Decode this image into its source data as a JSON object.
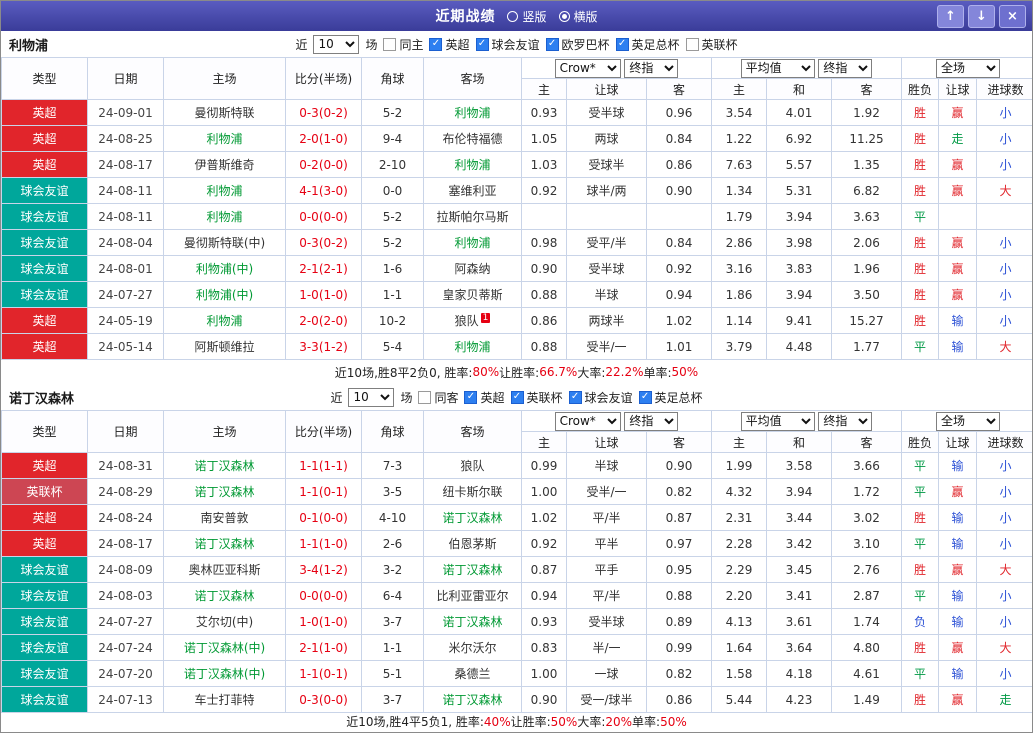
{
  "titlebar": {
    "title": "近期战绩",
    "radios": [
      {
        "label": "竖版",
        "selected": false
      },
      {
        "label": "横版",
        "selected": true
      }
    ],
    "icons": {
      "up": "↑",
      "down": "↓",
      "close": "×"
    }
  },
  "table": {
    "cols": [
      "类型",
      "日期",
      "主场",
      "比分(半场)",
      "角球",
      "客场"
    ],
    "groups": {
      "bookmaker": "Crow*",
      "final1": "终指",
      "average": "平均值",
      "final2": "终指",
      "full": "全场"
    },
    "asian_sub": [
      "主",
      "让球",
      "客"
    ],
    "euro_sub": [
      "主",
      "和",
      "客"
    ],
    "full_sub": [
      "胜负",
      "让球",
      "进球数"
    ]
  },
  "colors": {
    "type": {
      "英超": "#e1252b",
      "球会友谊": "#00a79b",
      "英联杯": "#cd4653"
    },
    "result": {
      "胜": "#e1252b",
      "平": "#009944",
      "负": "#2b50d5",
      "赢": "#e1252b",
      "走": "#009944",
      "输": "#2b50d5",
      "大": "#e1252b",
      "小": "#2b50d5"
    },
    "focus_team": "#009933",
    "score": "#e60012",
    "summary_label": "#222222",
    "summary_value": "#e60012"
  },
  "sections": [
    {
      "team": "利物浦",
      "filter": {
        "prefix": "近",
        "count": "10",
        "suffix": "场",
        "same": {
          "label": "同主",
          "checked": false
        },
        "leagues": [
          {
            "label": "英超",
            "checked": true
          },
          {
            "label": "球会友谊",
            "checked": true
          },
          {
            "label": "欧罗巴杯",
            "checked": true
          },
          {
            "label": "英足总杯",
            "checked": true
          },
          {
            "label": "英联杯",
            "checked": false
          }
        ]
      },
      "rows": [
        {
          "type": "英超",
          "date": "24-09-01",
          "home": "曼彻斯特联",
          "home_focus": false,
          "score": "0-3(0-2)",
          "corner": "5-2",
          "away": "利物浦",
          "away_focus": true,
          "asian": [
            "0.93",
            "受半球",
            "0.96"
          ],
          "euro": [
            "3.54",
            "4.01",
            "1.92"
          ],
          "full": [
            "胜",
            "赢",
            "小"
          ]
        },
        {
          "type": "英超",
          "date": "24-08-25",
          "home": "利物浦",
          "home_focus": true,
          "score": "2-0(1-0)",
          "corner": "9-4",
          "away": "布伦特福德",
          "away_focus": false,
          "asian": [
            "1.05",
            "两球",
            "0.84"
          ],
          "euro": [
            "1.22",
            "6.92",
            "11.25"
          ],
          "full": [
            "胜",
            "走",
            "小"
          ]
        },
        {
          "type": "英超",
          "date": "24-08-17",
          "home": "伊普斯维奇",
          "home_focus": false,
          "score": "0-2(0-0)",
          "corner": "2-10",
          "away": "利物浦",
          "away_focus": true,
          "asian": [
            "1.03",
            "受球半",
            "0.86"
          ],
          "euro": [
            "7.63",
            "5.57",
            "1.35"
          ],
          "full": [
            "胜",
            "赢",
            "小"
          ]
        },
        {
          "type": "球会友谊",
          "date": "24-08-11",
          "home": "利物浦",
          "home_focus": true,
          "score": "4-1(3-0)",
          "corner": "0-0",
          "away": "塞维利亚",
          "away_focus": false,
          "asian": [
            "0.92",
            "球半/两",
            "0.90"
          ],
          "euro": [
            "1.34",
            "5.31",
            "6.82"
          ],
          "full": [
            "胜",
            "赢",
            "大"
          ]
        },
        {
          "type": "球会友谊",
          "date": "24-08-11",
          "home": "利物浦",
          "home_focus": true,
          "score": "0-0(0-0)",
          "corner": "5-2",
          "away": "拉斯帕尔马斯",
          "away_focus": false,
          "asian": [
            "",
            "",
            ""
          ],
          "euro": [
            "1.79",
            "3.94",
            "3.63"
          ],
          "full": [
            "平",
            "",
            ""
          ]
        },
        {
          "type": "球会友谊",
          "date": "24-08-04",
          "home": "曼彻斯特联(中)",
          "home_focus": false,
          "score": "0-3(0-2)",
          "corner": "5-2",
          "away": "利物浦",
          "away_focus": true,
          "asian": [
            "0.98",
            "受平/半",
            "0.84"
          ],
          "euro": [
            "2.86",
            "3.98",
            "2.06"
          ],
          "full": [
            "胜",
            "赢",
            "小"
          ]
        },
        {
          "type": "球会友谊",
          "date": "24-08-01",
          "home": "利物浦(中)",
          "home_focus": true,
          "score": "2-1(2-1)",
          "corner": "1-6",
          "away": "阿森纳",
          "away_focus": false,
          "asian": [
            "0.90",
            "受半球",
            "0.92"
          ],
          "euro": [
            "3.16",
            "3.83",
            "1.96"
          ],
          "full": [
            "胜",
            "赢",
            "小"
          ]
        },
        {
          "type": "球会友谊",
          "date": "24-07-27",
          "home": "利物浦(中)",
          "home_focus": true,
          "score": "1-0(1-0)",
          "corner": "1-1",
          "away": "皇家贝蒂斯",
          "away_focus": false,
          "asian": [
            "0.88",
            "半球",
            "0.94"
          ],
          "euro": [
            "1.86",
            "3.94",
            "3.50"
          ],
          "full": [
            "胜",
            "赢",
            "小"
          ]
        },
        {
          "type": "英超",
          "date": "24-05-19",
          "home": "利物浦",
          "home_focus": true,
          "score": "2-0(2-0)",
          "corner": "10-2",
          "away": "狼队",
          "away_focus": false,
          "away_redcard": "1",
          "asian": [
            "0.86",
            "两球半",
            "1.02"
          ],
          "euro": [
            "1.14",
            "9.41",
            "15.27"
          ],
          "full": [
            "胜",
            "输",
            "小"
          ]
        },
        {
          "type": "英超",
          "date": "24-05-14",
          "home": "阿斯顿维拉",
          "home_focus": false,
          "score": "3-3(1-2)",
          "corner": "5-4",
          "away": "利物浦",
          "away_focus": true,
          "asian": [
            "0.88",
            "受半/一",
            "1.01"
          ],
          "euro": [
            "3.79",
            "4.48",
            "1.77"
          ],
          "full": [
            "平",
            "输",
            "大"
          ]
        }
      ],
      "summary": [
        {
          "text": "近10场,胜8平2负0, 胜率:",
          "red": false
        },
        {
          "text": "80%",
          "red": true
        },
        {
          "text": " 让胜率:",
          "red": false
        },
        {
          "text": "66.7%",
          "red": true
        },
        {
          "text": " 大率:",
          "red": false
        },
        {
          "text": "22.2%",
          "red": true
        },
        {
          "text": " 单率:",
          "red": false
        },
        {
          "text": "50%",
          "red": true
        }
      ]
    },
    {
      "team": "诺丁汉森林",
      "filter": {
        "prefix": "近",
        "count": "10",
        "suffix": "场",
        "same": {
          "label": "同客",
          "checked": false
        },
        "leagues": [
          {
            "label": "英超",
            "checked": true
          },
          {
            "label": "英联杯",
            "checked": true
          },
          {
            "label": "球会友谊",
            "checked": true
          },
          {
            "label": "英足总杯",
            "checked": true
          }
        ]
      },
      "rows": [
        {
          "type": "英超",
          "date": "24-08-31",
          "home": "诺丁汉森林",
          "home_focus": true,
          "score": "1-1(1-1)",
          "corner": "7-3",
          "away": "狼队",
          "away_focus": false,
          "asian": [
            "0.99",
            "半球",
            "0.90"
          ],
          "euro": [
            "1.99",
            "3.58",
            "3.66"
          ],
          "full": [
            "平",
            "输",
            "小"
          ]
        },
        {
          "type": "英联杯",
          "date": "24-08-29",
          "home": "诺丁汉森林",
          "home_focus": true,
          "score": "1-1(0-1)",
          "corner": "3-5",
          "away": "纽卡斯尔联",
          "away_focus": false,
          "asian": [
            "1.00",
            "受半/一",
            "0.82"
          ],
          "euro": [
            "4.32",
            "3.94",
            "1.72"
          ],
          "full": [
            "平",
            "赢",
            "小"
          ]
        },
        {
          "type": "英超",
          "date": "24-08-24",
          "home": "南安普敦",
          "home_focus": false,
          "score": "0-1(0-0)",
          "corner": "4-10",
          "away": "诺丁汉森林",
          "away_focus": true,
          "asian": [
            "1.02",
            "平/半",
            "0.87"
          ],
          "euro": [
            "2.31",
            "3.44",
            "3.02"
          ],
          "full": [
            "胜",
            "输",
            "小"
          ]
        },
        {
          "type": "英超",
          "date": "24-08-17",
          "home": "诺丁汉森林",
          "home_focus": true,
          "score": "1-1(1-0)",
          "corner": "2-6",
          "away": "伯恩茅斯",
          "away_focus": false,
          "asian": [
            "0.92",
            "平半",
            "0.97"
          ],
          "euro": [
            "2.28",
            "3.42",
            "3.10"
          ],
          "full": [
            "平",
            "输",
            "小"
          ]
        },
        {
          "type": "球会友谊",
          "date": "24-08-09",
          "home": "奥林匹亚科斯",
          "home_focus": false,
          "score": "3-4(1-2)",
          "corner": "3-2",
          "away": "诺丁汉森林",
          "away_focus": true,
          "asian": [
            "0.87",
            "平手",
            "0.95"
          ],
          "euro": [
            "2.29",
            "3.45",
            "2.76"
          ],
          "full": [
            "胜",
            "赢",
            "大"
          ]
        },
        {
          "type": "球会友谊",
          "date": "24-08-03",
          "home": "诺丁汉森林",
          "home_focus": true,
          "score": "0-0(0-0)",
          "corner": "6-4",
          "away": "比利亚雷亚尔",
          "away_focus": false,
          "asian": [
            "0.94",
            "平/半",
            "0.88"
          ],
          "euro": [
            "2.20",
            "3.41",
            "2.87"
          ],
          "full": [
            "平",
            "输",
            "小"
          ]
        },
        {
          "type": "球会友谊",
          "date": "24-07-27",
          "home": "艾尔切(中)",
          "home_focus": false,
          "score": "1-0(1-0)",
          "corner": "3-7",
          "away": "诺丁汉森林",
          "away_focus": true,
          "asian": [
            "0.93",
            "受半球",
            "0.89"
          ],
          "euro": [
            "4.13",
            "3.61",
            "1.74"
          ],
          "full": [
            "负",
            "输",
            "小"
          ]
        },
        {
          "type": "球会友谊",
          "date": "24-07-24",
          "home": "诺丁汉森林(中)",
          "home_focus": true,
          "score": "2-1(1-0)",
          "corner": "1-1",
          "away": "米尔沃尔",
          "away_focus": false,
          "asian": [
            "0.83",
            "半/一",
            "0.99"
          ],
          "euro": [
            "1.64",
            "3.64",
            "4.80"
          ],
          "full": [
            "胜",
            "赢",
            "大"
          ]
        },
        {
          "type": "球会友谊",
          "date": "24-07-20",
          "home": "诺丁汉森林(中)",
          "home_focus": true,
          "score": "1-1(0-1)",
          "corner": "5-1",
          "away": "桑德兰",
          "away_focus": false,
          "asian": [
            "1.00",
            "一球",
            "0.82"
          ],
          "euro": [
            "1.58",
            "4.18",
            "4.61"
          ],
          "full": [
            "平",
            "输",
            "小"
          ]
        },
        {
          "type": "球会友谊",
          "date": "24-07-13",
          "home": "车士打菲特",
          "home_focus": false,
          "score": "0-3(0-0)",
          "corner": "3-7",
          "away": "诺丁汉森林",
          "away_focus": true,
          "asian": [
            "0.90",
            "受一/球半",
            "0.86"
          ],
          "euro": [
            "5.44",
            "4.23",
            "1.49"
          ],
          "full": [
            "胜",
            "赢",
            "走"
          ]
        }
      ],
      "summary": [
        {
          "text": "近10场,胜4平5负1, 胜率:",
          "red": false
        },
        {
          "text": "40%",
          "red": true
        },
        {
          "text": " 让胜率:",
          "red": false
        },
        {
          "text": "50%",
          "red": true
        },
        {
          "text": " 大率:",
          "red": false
        },
        {
          "text": "20%",
          "red": true
        },
        {
          "text": " 单率:",
          "red": false
        },
        {
          "text": "50%",
          "red": true
        }
      ]
    }
  ]
}
